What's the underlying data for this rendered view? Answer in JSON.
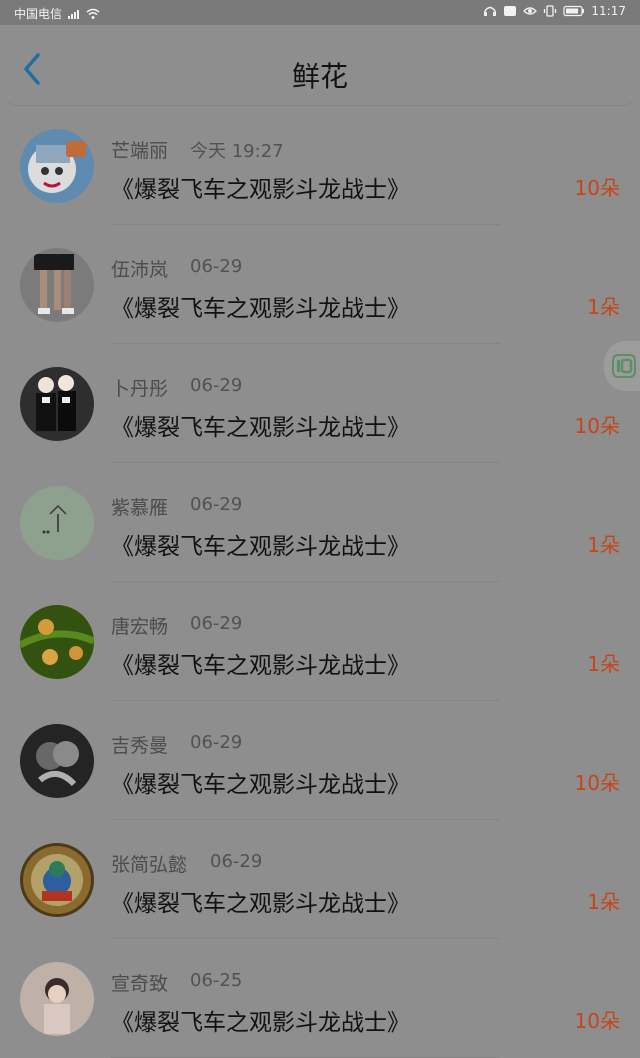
{
  "status": {
    "carrier": "中国电信",
    "time": "11:17"
  },
  "header": {
    "title": "鲜花"
  },
  "records": [
    {
      "name": "芒端丽",
      "date": "今天 19:27",
      "title": "《爆裂飞车之观影斗龙战士》",
      "count": "10朵",
      "avatar_icon": "cartoon-bear-avatar"
    },
    {
      "name": "伍沛岚",
      "date": "06-29",
      "title": "《爆裂飞车之观影斗龙战士》",
      "count": "1朵",
      "avatar_icon": "legs-photo-avatar"
    },
    {
      "name": "卜丹彤",
      "date": "06-29",
      "title": "《爆裂飞车之观影斗龙战士》",
      "count": "10朵",
      "avatar_icon": "couple-photo-avatar"
    },
    {
      "name": "紫慕雁",
      "date": "06-29",
      "title": "《爆裂飞车之观影斗龙战士》",
      "count": "1朵",
      "avatar_icon": "tree-landscape-avatar"
    },
    {
      "name": "唐宏畅",
      "date": "06-29",
      "title": "《爆裂飞车之观影斗龙战士》",
      "count": "1朵",
      "avatar_icon": "green-branch-avatar"
    },
    {
      "name": "吉秀曼",
      "date": "06-29",
      "title": "《爆裂飞车之观影斗龙战士》",
      "count": "10朵",
      "avatar_icon": "bw-couple-avatar"
    },
    {
      "name": "张简弘懿",
      "date": "06-29",
      "title": "《爆裂飞车之观影斗龙战士》",
      "count": "1朵",
      "avatar_icon": "mandala-avatar"
    },
    {
      "name": "宣奇致",
      "date": "06-25",
      "title": "《爆裂飞车之观影斗龙战士》",
      "count": "10朵",
      "avatar_icon": "girl-portrait-avatar"
    }
  ],
  "colors": {
    "count": "#c84418",
    "back_arrow": "#1f6ea4"
  }
}
